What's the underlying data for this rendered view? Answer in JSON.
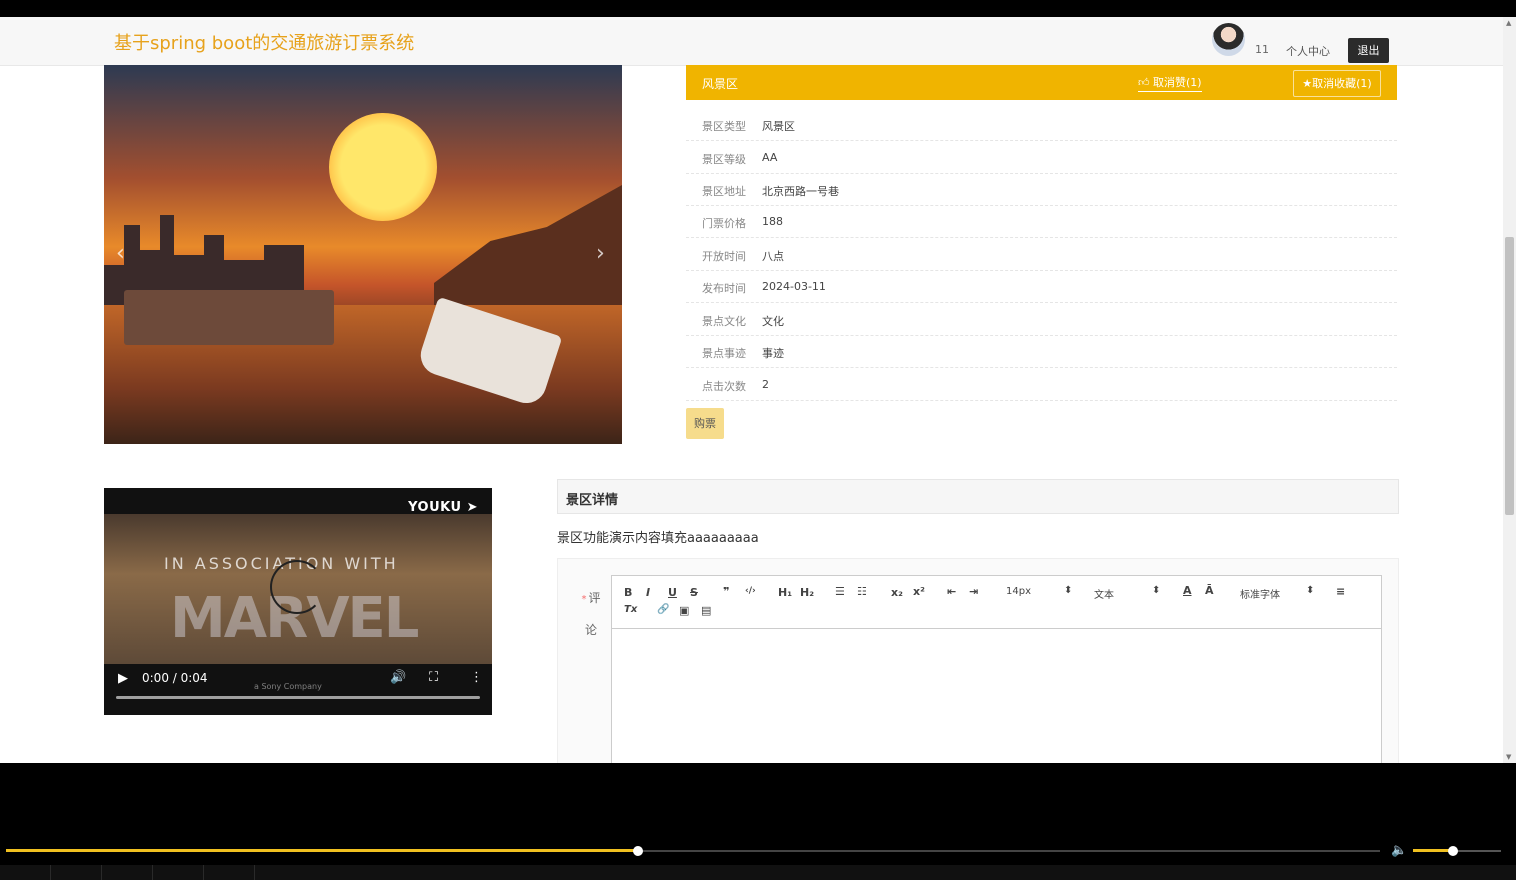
{
  "header": {
    "site_title": "基于spring boot的交通旅游订票系统",
    "username": "11",
    "personal_center": "个人中心",
    "logout": "退出"
  },
  "spot": {
    "name": "风景区",
    "unlike_label": "取消赞(1)",
    "unfavorite_label": "★取消收藏(1)",
    "details": [
      {
        "label": "景区类型",
        "value": "风景区"
      },
      {
        "label": "景区等级",
        "value": "AA"
      },
      {
        "label": "景区地址",
        "value": "北京西路一号巷"
      },
      {
        "label": "门票价格",
        "value": "188"
      },
      {
        "label": "开放时间",
        "value": "八点"
      },
      {
        "label": "发布时间",
        "value": "2024-03-11"
      },
      {
        "label": "景点文化",
        "value": "文化"
      },
      {
        "label": "景点事迹",
        "value": "事迹"
      },
      {
        "label": "点击次数",
        "value": "2"
      }
    ],
    "buy_label": "购票"
  },
  "carousel": {
    "prev": "‹",
    "next": "›"
  },
  "video": {
    "brand": "YOUKU ➤",
    "overlay_line1": "IN ASSOCIATION WITH",
    "overlay_line2": "MARVEL",
    "overlay_line3": "a Sony Company",
    "time": "0:00 / 0:04",
    "play_icon": "▶",
    "volume_icon": "🔊",
    "fullscreen_icon": "⛶",
    "more_icon": "⋮"
  },
  "detail_section": {
    "title": "景区详情",
    "content": "景区功能演示内容填充aaaaaaaaa"
  },
  "comment": {
    "required_mark": "*",
    "label": "评论",
    "toolbar": {
      "bold": "B",
      "italic": "I",
      "underline": "U",
      "strike": "S",
      "quote": "❞",
      "code": "‹/›",
      "h1": "H₁",
      "h2": "H₂",
      "ordered_list": "☰",
      "bullet_list": "☷",
      "subscript": "x₂",
      "superscript": "x²",
      "outdent": "⇤",
      "indent": "⇥",
      "font_size": "14px",
      "header_select": "文本",
      "font_color": "A",
      "background": "Ā",
      "font_family": "标准字体",
      "align": "≡",
      "clean": "Tx",
      "link": "🔗",
      "image": "▣",
      "video": "▤",
      "select_arrow": "⬍"
    }
  },
  "player": {
    "volume_icon": "🔈"
  },
  "colors": {
    "accent": "#f0b400",
    "title": "#e7a21c"
  }
}
